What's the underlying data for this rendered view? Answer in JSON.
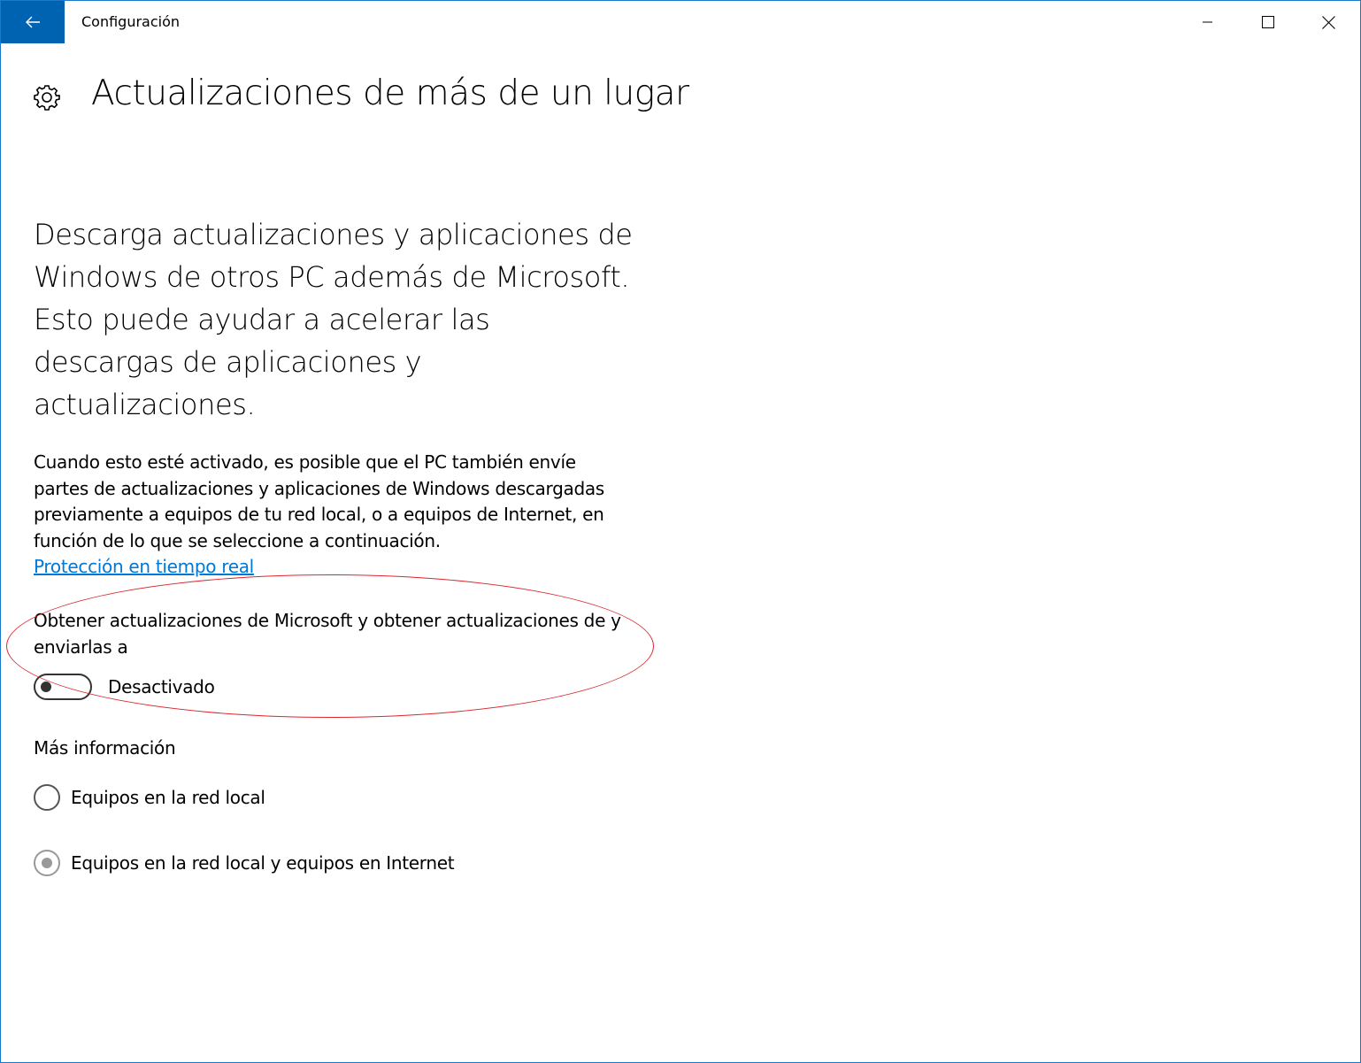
{
  "window": {
    "title": "Configuración",
    "accent_color": "#0063b1",
    "controls": {
      "minimize": "minimize-icon",
      "maximize": "maximize-icon",
      "close": "close-icon"
    }
  },
  "header": {
    "icon": "gear-icon",
    "title": "Actualizaciones de más de un lugar"
  },
  "main": {
    "intro": "Descarga actualizaciones y aplicaciones de Windows de otros PC además de Microsoft. Esto puede ayudar a acelerar las descargas de aplicaciones y actualizaciones.",
    "description": "Cuando esto esté activado, es posible que el PC también envíe partes de actualizaciones y aplicaciones de Windows descargadas previamente a equipos de tu red local, o a equipos de Internet, en función de lo que se seleccione a continuación.",
    "link_label": "Protección en tiempo real",
    "link_color": "#0078d7",
    "toggle": {
      "label": "Obtener actualizaciones de Microsoft y obtener actualizaciones de y enviarlas a",
      "state_label": "Desactivado",
      "on": false
    },
    "highlight_color": "#d9272e",
    "more_info_label": "Más información",
    "radio_options": [
      {
        "label": "Equipos en la red local",
        "selected": false
      },
      {
        "label": "Equipos en la red local y equipos en Internet",
        "selected": true
      }
    ]
  }
}
